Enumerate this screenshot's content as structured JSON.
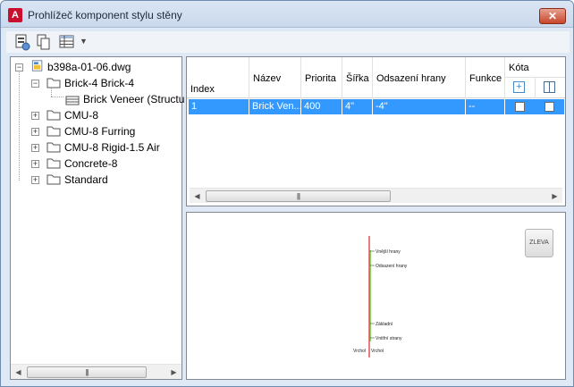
{
  "window": {
    "title": "Prohlížeč komponent stylu stěny",
    "close_label": "✕",
    "app_icon_letter": "A"
  },
  "toolbar": {
    "buttons": [
      "style-icon",
      "copy-icon",
      "table-icon"
    ],
    "dropdown_arrow": "▼"
  },
  "tree": {
    "root": "b398a-01-06.dwg",
    "items": [
      {
        "label": "Brick-4 Brick-4",
        "expanded": true
      },
      {
        "label": "Brick Veneer (Structu",
        "child": true
      },
      {
        "label": "CMU-8"
      },
      {
        "label": "CMU-8 Furring"
      },
      {
        "label": "CMU-8 Rigid-1.5 Air"
      },
      {
        "label": "Concrete-8"
      },
      {
        "label": "Standard"
      }
    ]
  },
  "grid": {
    "columns": {
      "index": "Index",
      "nazev": "Název",
      "priorita": "Priorita",
      "sirka": "Šířka",
      "odsazeni": "Odsazení hrany",
      "funkce": "Funkce",
      "kota": "Kóta"
    },
    "rows": [
      {
        "index": "1",
        "nazev": "Brick Ven...",
        "priorita": "400",
        "sirka": "4\"",
        "odsazeni": "-4\"",
        "funkce": "--"
      }
    ]
  },
  "scroll": {
    "grip": "|||"
  },
  "preview": {
    "button": "ZLEVA",
    "labels": [
      "Vnější hrany",
      "Odsazení hrany",
      "Základní",
      "Vnitřní strany",
      "Vrchol",
      "Vrchol"
    ]
  },
  "colors": {
    "selection": "#3399ff",
    "preview_wall": "#66cc33",
    "preview_marker": "#cc0000"
  }
}
